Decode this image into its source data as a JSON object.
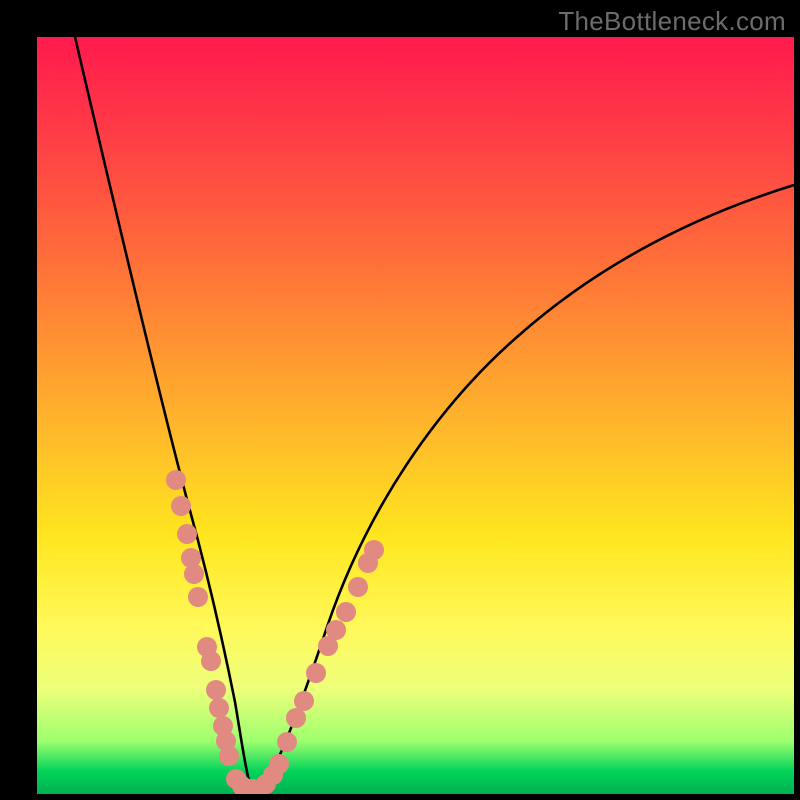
{
  "watermark": "TheBottleneck.com",
  "chart_data": {
    "type": "line",
    "title": "",
    "xlabel": "",
    "ylabel": "",
    "xlim": [
      0,
      100
    ],
    "ylim": [
      0,
      100
    ],
    "background_gradient": {
      "top": "red",
      "middle": "yellow",
      "bottom": "green",
      "meaning": "higher value = worse (red), lower value near minimum = best (green)"
    },
    "series": [
      {
        "name": "bottleneck-curve",
        "color": "#000000",
        "x": [
          5,
          10,
          15,
          18,
          20,
          22,
          24,
          26,
          27,
          28,
          30,
          35,
          40,
          45,
          50,
          55,
          60,
          70,
          80,
          90,
          100
        ],
        "values": [
          100,
          80,
          57,
          43,
          33,
          22,
          12,
          4,
          1,
          0.5,
          1.5,
          11,
          22,
          33,
          42,
          49,
          55,
          64,
          71,
          76,
          80
        ]
      }
    ],
    "annotations": {
      "soft_dot_clusters": [
        {
          "name": "left-branch-dots",
          "points": [
            {
              "x": 18.4,
              "y": 41.5
            },
            {
              "x": 19.0,
              "y": 38.0
            },
            {
              "x": 19.8,
              "y": 34.3
            },
            {
              "x": 20.4,
              "y": 31.2
            },
            {
              "x": 20.7,
              "y": 29.0
            },
            {
              "x": 21.3,
              "y": 26.0
            },
            {
              "x": 22.5,
              "y": 19.4
            },
            {
              "x": 22.9,
              "y": 17.6
            },
            {
              "x": 23.6,
              "y": 13.7
            },
            {
              "x": 24.1,
              "y": 11.3
            },
            {
              "x": 24.5,
              "y": 9.0
            },
            {
              "x": 24.9,
              "y": 7.0
            },
            {
              "x": 25.4,
              "y": 5.0
            }
          ]
        },
        {
          "name": "trough-dots",
          "points": [
            {
              "x": 26.3,
              "y": 2.0
            },
            {
              "x": 27.0,
              "y": 1.0
            },
            {
              "x": 27.8,
              "y": 0.6
            },
            {
              "x": 28.5,
              "y": 0.6
            },
            {
              "x": 29.5,
              "y": 0.7
            },
            {
              "x": 30.3,
              "y": 1.3
            },
            {
              "x": 31.2,
              "y": 2.5
            },
            {
              "x": 32.0,
              "y": 4.0
            }
          ]
        },
        {
          "name": "right-branch-dots",
          "points": [
            {
              "x": 33.0,
              "y": 6.8
            },
            {
              "x": 34.2,
              "y": 10.0
            },
            {
              "x": 35.2,
              "y": 12.3
            },
            {
              "x": 36.8,
              "y": 16.0
            },
            {
              "x": 38.5,
              "y": 19.6
            },
            {
              "x": 39.5,
              "y": 21.6
            },
            {
              "x": 40.8,
              "y": 24.0
            },
            {
              "x": 42.4,
              "y": 27.3
            },
            {
              "x": 43.8,
              "y": 30.5
            },
            {
              "x": 44.5,
              "y": 32.3
            }
          ]
        }
      ]
    },
    "minimum": {
      "x": 28,
      "y": 0.5
    }
  }
}
